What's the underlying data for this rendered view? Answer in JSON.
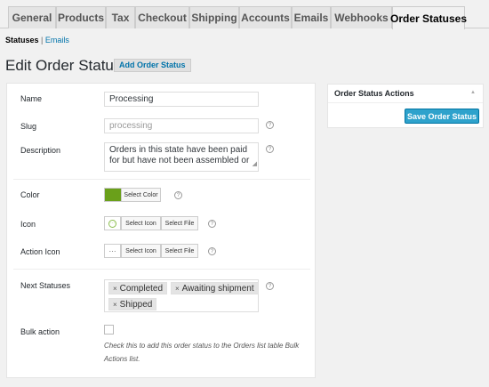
{
  "tabs": [
    "General",
    "Products",
    "Tax",
    "Checkout",
    "Shipping",
    "Accounts",
    "Emails",
    "Webhooks",
    "Order Statuses"
  ],
  "subnav": {
    "current": "Statuses",
    "separator": "|",
    "link": "Emails"
  },
  "page": {
    "title": "Edit Order Status",
    "add_button": "Add Order Status"
  },
  "form": {
    "name_label": "Name",
    "name_value": "Processing",
    "slug_label": "Slug",
    "slug_placeholder": "processing",
    "description_label": "Description",
    "description_value": "Orders in this state have been paid for but have not been assembled or",
    "color_label": "Color",
    "color_value": "#6aa01a",
    "select_color": "Select Color",
    "icon_label": "Icon",
    "select_icon": "Select Icon",
    "select_file": "Select File",
    "action_icon_label": "Action Icon",
    "action_icon_glyph": "···",
    "next_statuses_label": "Next Statuses",
    "next_statuses": [
      "Completed",
      "Awaiting shipment",
      "Shipped"
    ],
    "bulk_label": "Bulk action",
    "bulk_checked": false,
    "bulk_desc": "Check this to add this order status to the Orders list table Bulk Actions list."
  },
  "sidebox": {
    "title": "Order Status Actions",
    "save_button": "Save Order Status"
  }
}
